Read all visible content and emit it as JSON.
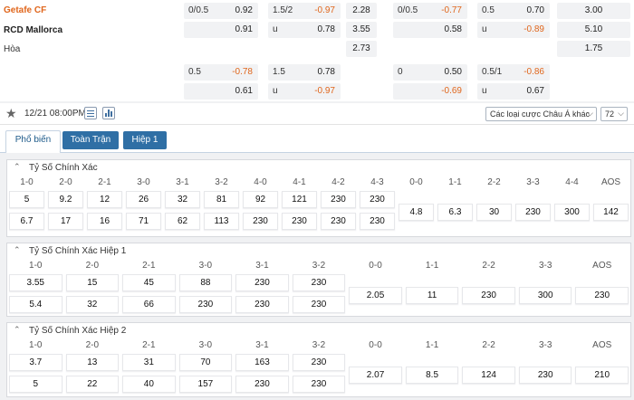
{
  "match": {
    "home": "Getafe CF",
    "away": "RCD Mallorca",
    "draw": "Hòa"
  },
  "odds_rows": [
    [
      {
        "l": "0/0.5",
        "r": "0.92",
        "neg": false
      },
      {
        "l": "1.5/2",
        "r": "-0.97",
        "neg": true
      },
      {
        "c": "2.28"
      },
      {
        "l": "0/0.5",
        "r": "-0.77",
        "neg": true
      },
      {
        "l": "0.5",
        "r": "0.70",
        "neg": false
      },
      {
        "c": "3.00"
      }
    ],
    [
      {
        "l": "",
        "r": "0.91",
        "neg": false
      },
      {
        "l": "u",
        "r": "0.78",
        "neg": false
      },
      {
        "c": "3.55"
      },
      {
        "l": "",
        "r": "0.58",
        "neg": false
      },
      {
        "l": "u",
        "r": "-0.89",
        "neg": true
      },
      {
        "c": "5.10"
      }
    ],
    [
      null,
      null,
      {
        "c": "2.73"
      },
      null,
      null,
      {
        "c": "1.75"
      }
    ],
    [
      {
        "l": "0.5",
        "r": "-0.78",
        "neg": true
      },
      {
        "l": "1.5",
        "r": "0.78",
        "neg": false
      },
      null,
      {
        "l": "0",
        "r": "0.50",
        "neg": false
      },
      {
        "l": "0.5/1",
        "r": "-0.86",
        "neg": true
      },
      null
    ],
    [
      {
        "l": "",
        "r": "0.61",
        "neg": false
      },
      {
        "l": "u",
        "r": "-0.97",
        "neg": true
      },
      null,
      {
        "l": "",
        "r": "-0.69",
        "neg": true
      },
      {
        "l": "u",
        "r": "0.67",
        "neg": false
      },
      null
    ]
  ],
  "toolbar": {
    "datetime": "12/21 08:00PM",
    "bet_type": "Các loại cược Châu Á khác",
    "count": "72"
  },
  "tabs": [
    "Phổ biến",
    "Toàn Trận",
    "Hiệp 1"
  ],
  "sections": [
    {
      "title": "Tỷ Số Chính Xác",
      "cols": [
        {
          "h": "1-0",
          "v": [
            "5",
            "6.7"
          ]
        },
        {
          "h": "2-0",
          "v": [
            "9.2",
            "17"
          ]
        },
        {
          "h": "2-1",
          "v": [
            "12",
            "16"
          ]
        },
        {
          "h": "3-0",
          "v": [
            "26",
            "71"
          ]
        },
        {
          "h": "3-1",
          "v": [
            "32",
            "62"
          ]
        },
        {
          "h": "3-2",
          "v": [
            "81",
            "113"
          ]
        },
        {
          "h": "4-0",
          "v": [
            "92",
            "230"
          ]
        },
        {
          "h": "4-1",
          "v": [
            "121",
            "230"
          ]
        },
        {
          "h": "4-2",
          "v": [
            "230",
            "230"
          ]
        },
        {
          "h": "4-3",
          "v": [
            "230",
            "230"
          ]
        },
        {
          "h": "0-0",
          "v": [
            "4.8"
          ]
        },
        {
          "h": "1-1",
          "v": [
            "6.3"
          ]
        },
        {
          "h": "2-2",
          "v": [
            "30"
          ]
        },
        {
          "h": "3-3",
          "v": [
            "230"
          ]
        },
        {
          "h": "4-4",
          "v": [
            "300"
          ]
        },
        {
          "h": "AOS",
          "v": [
            "142"
          ]
        }
      ]
    },
    {
      "title": "Tỷ Số Chính Xác Hiệp 1",
      "cols": [
        {
          "h": "1-0",
          "v": [
            "3.55",
            "5.4"
          ]
        },
        {
          "h": "2-0",
          "v": [
            "15",
            "32"
          ]
        },
        {
          "h": "2-1",
          "v": [
            "45",
            "66"
          ]
        },
        {
          "h": "3-0",
          "v": [
            "88",
            "230"
          ]
        },
        {
          "h": "3-1",
          "v": [
            "230",
            "230"
          ]
        },
        {
          "h": "3-2",
          "v": [
            "230",
            "230"
          ]
        },
        {
          "h": "0-0",
          "v": [
            "2.05"
          ]
        },
        {
          "h": "1-1",
          "v": [
            "11"
          ]
        },
        {
          "h": "2-2",
          "v": [
            "230"
          ]
        },
        {
          "h": "3-3",
          "v": [
            "300"
          ]
        },
        {
          "h": "AOS",
          "v": [
            "230"
          ]
        }
      ]
    },
    {
      "title": "Tỷ Số Chính Xác Hiệp 2",
      "cols": [
        {
          "h": "1-0",
          "v": [
            "3.7",
            "5"
          ]
        },
        {
          "h": "2-0",
          "v": [
            "13",
            "22"
          ]
        },
        {
          "h": "2-1",
          "v": [
            "31",
            "40"
          ]
        },
        {
          "h": "3-0",
          "v": [
            "70",
            "157"
          ]
        },
        {
          "h": "3-1",
          "v": [
            "163",
            "230"
          ]
        },
        {
          "h": "3-2",
          "v": [
            "230",
            "230"
          ]
        },
        {
          "h": "0-0",
          "v": [
            "2.07"
          ]
        },
        {
          "h": "1-1",
          "v": [
            "8.5"
          ]
        },
        {
          "h": "2-2",
          "v": [
            "124"
          ]
        },
        {
          "h": "3-3",
          "v": [
            "230"
          ]
        },
        {
          "h": "AOS",
          "v": [
            "210"
          ]
        }
      ]
    }
  ]
}
